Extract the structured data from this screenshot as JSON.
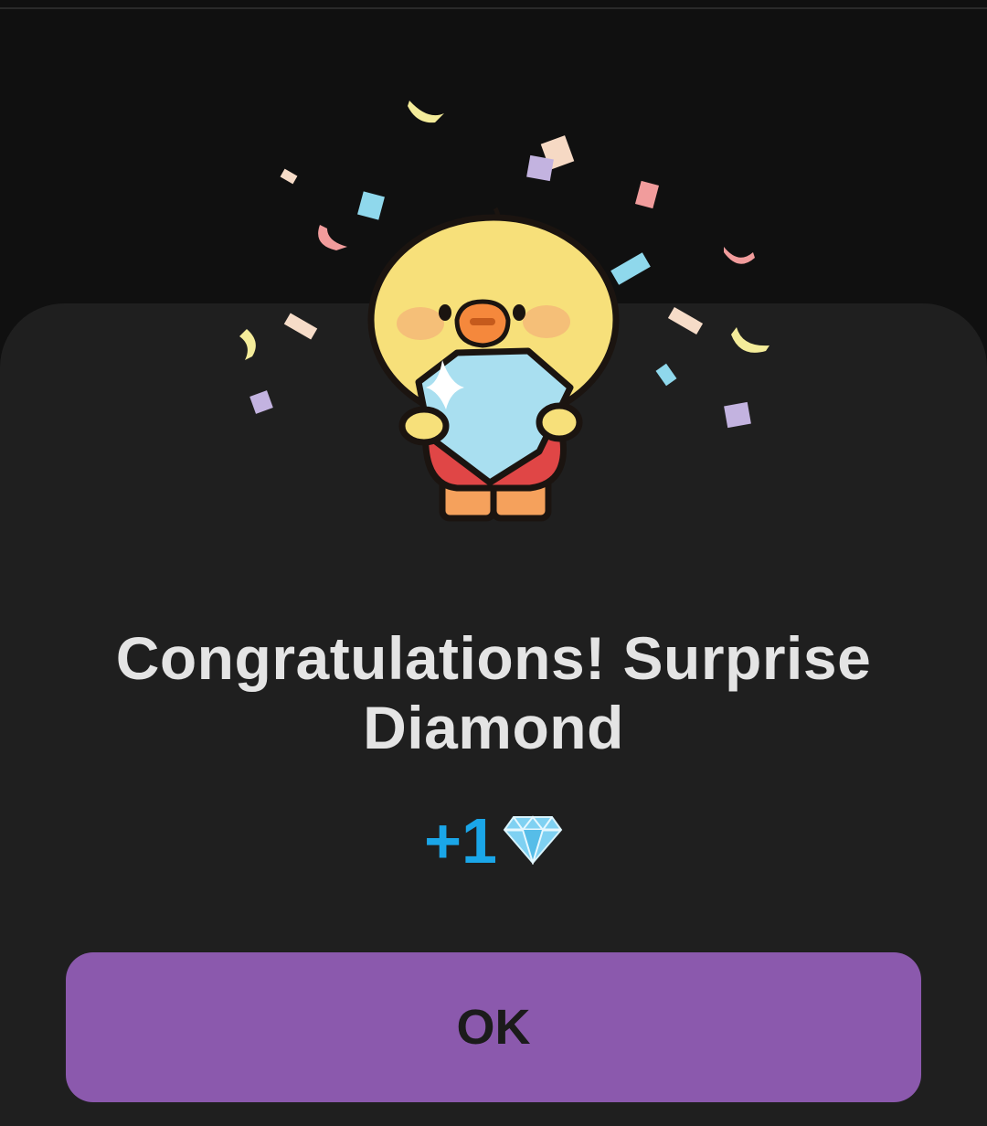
{
  "dialog": {
    "title": "Congratulations! Surprise Diamond",
    "reward": {
      "amount": "+1",
      "icon": "diamond-icon"
    },
    "ok_label": "OK",
    "illustration": "duck-holding-diamond"
  },
  "colors": {
    "sheet_background": "#1f1f1f",
    "page_background": "#101010",
    "title_text": "#e4e4e4",
    "reward_text": "#1aa6e8",
    "ok_button": "#8b59ad",
    "ok_text": "#1b1b1b"
  }
}
